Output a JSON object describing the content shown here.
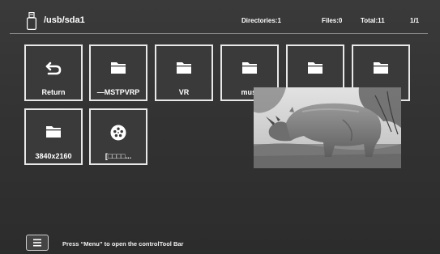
{
  "header": {
    "path": "/usb/sda1",
    "directories": "Directories:1",
    "files": "Files:0",
    "total": "Total:11",
    "page": "1/1"
  },
  "tiles": [
    {
      "label": "Return",
      "icon": "return-icon"
    },
    {
      "label": "—MSTPVRP",
      "icon": "folder-icon"
    },
    {
      "label": "VR",
      "icon": "folder-icon"
    },
    {
      "label": "musi",
      "icon": "folder-icon"
    },
    {
      "label": "",
      "icon": "folder-icon"
    },
    {
      "label": "",
      "icon": "folder-icon"
    },
    {
      "label": "3840x2160",
      "icon": "folder-icon"
    },
    {
      "label": "[□□□□...",
      "icon": "media-file-icon"
    }
  ],
  "preview": {
    "subject": "rhinoceros"
  },
  "footer": {
    "hint": "Press “Menu” to open the controlTool Bar",
    "menu_icon": "menu-icon"
  }
}
